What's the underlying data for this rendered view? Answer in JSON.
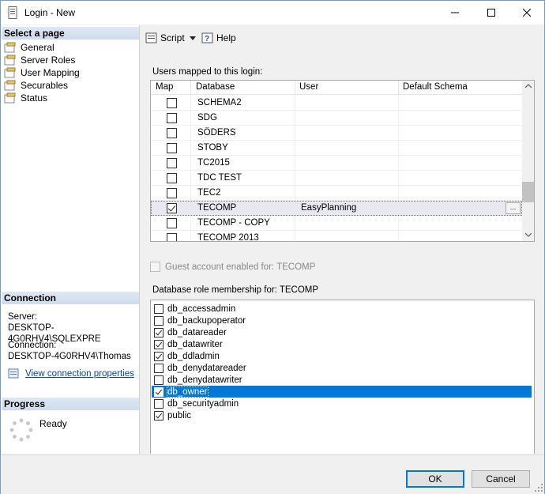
{
  "window": {
    "title": "Login - New"
  },
  "left": {
    "select_page_header": "Select a page",
    "pages": [
      {
        "label": "General",
        "icon": "wrench-page-icon"
      },
      {
        "label": "Server Roles",
        "icon": "wrench-page-icon"
      },
      {
        "label": "User Mapping",
        "icon": "wrench-page-icon"
      },
      {
        "label": "Securables",
        "icon": "wrench-page-icon"
      },
      {
        "label": "Status",
        "icon": "wrench-page-icon"
      }
    ],
    "connection_header": "Connection",
    "server_label": "Server:",
    "server_value": "DESKTOP-4G0RHV4\\SQLEXPRE",
    "connection_label": "Connection:",
    "connection_value": "DESKTOP-4G0RHV4\\Thomas",
    "view_props_link": "View connection properties",
    "progress_header": "Progress",
    "progress_status": "Ready"
  },
  "toolbar": {
    "script_label": "Script",
    "help_label": "Help"
  },
  "users_mapped": {
    "label": "Users mapped to this login:",
    "columns": [
      "Map",
      "Database",
      "User",
      "Default Schema"
    ],
    "rows": [
      {
        "checked": false,
        "database": "SCHEMA2",
        "user": "",
        "schema": ""
      },
      {
        "checked": false,
        "database": "SDG",
        "user": "",
        "schema": ""
      },
      {
        "checked": false,
        "database": "SÖDERS",
        "user": "",
        "schema": ""
      },
      {
        "checked": false,
        "database": "STOBY",
        "user": "",
        "schema": ""
      },
      {
        "checked": false,
        "database": "TC2015",
        "user": "",
        "schema": ""
      },
      {
        "checked": false,
        "database": "TDC TEST",
        "user": "",
        "schema": ""
      },
      {
        "checked": false,
        "database": "TEC2",
        "user": "",
        "schema": ""
      },
      {
        "checked": true,
        "database": "TECOMP",
        "user": "EasyPlanning",
        "schema": "",
        "selected": true
      },
      {
        "checked": false,
        "database": "TECOMP - COPY",
        "user": "",
        "schema": ""
      },
      {
        "checked": false,
        "database": "TECOMP 2013",
        "user": "",
        "schema": ""
      }
    ],
    "ellipsis": "..."
  },
  "guest": {
    "label": "Guest account enabled for: TECOMP",
    "enabled": false
  },
  "roles": {
    "label": "Database role membership for: TECOMP",
    "items": [
      {
        "name": "db_accessadmin",
        "checked": false
      },
      {
        "name": "db_backupoperator",
        "checked": false
      },
      {
        "name": "db_datareader",
        "checked": true
      },
      {
        "name": "db_datawriter",
        "checked": true
      },
      {
        "name": "db_ddladmin",
        "checked": true
      },
      {
        "name": "db_denydatareader",
        "checked": false
      },
      {
        "name": "db_denydatawriter",
        "checked": false
      },
      {
        "name": "db_owner",
        "checked": true,
        "selected": true
      },
      {
        "name": "db_securityadmin",
        "checked": false
      },
      {
        "name": "public",
        "checked": true
      }
    ]
  },
  "footer": {
    "ok_label": "OK",
    "cancel_label": "Cancel"
  },
  "colors": {
    "selection": "#0078d7",
    "link": "#0645ad",
    "header_grad": "#dfe8f4"
  }
}
